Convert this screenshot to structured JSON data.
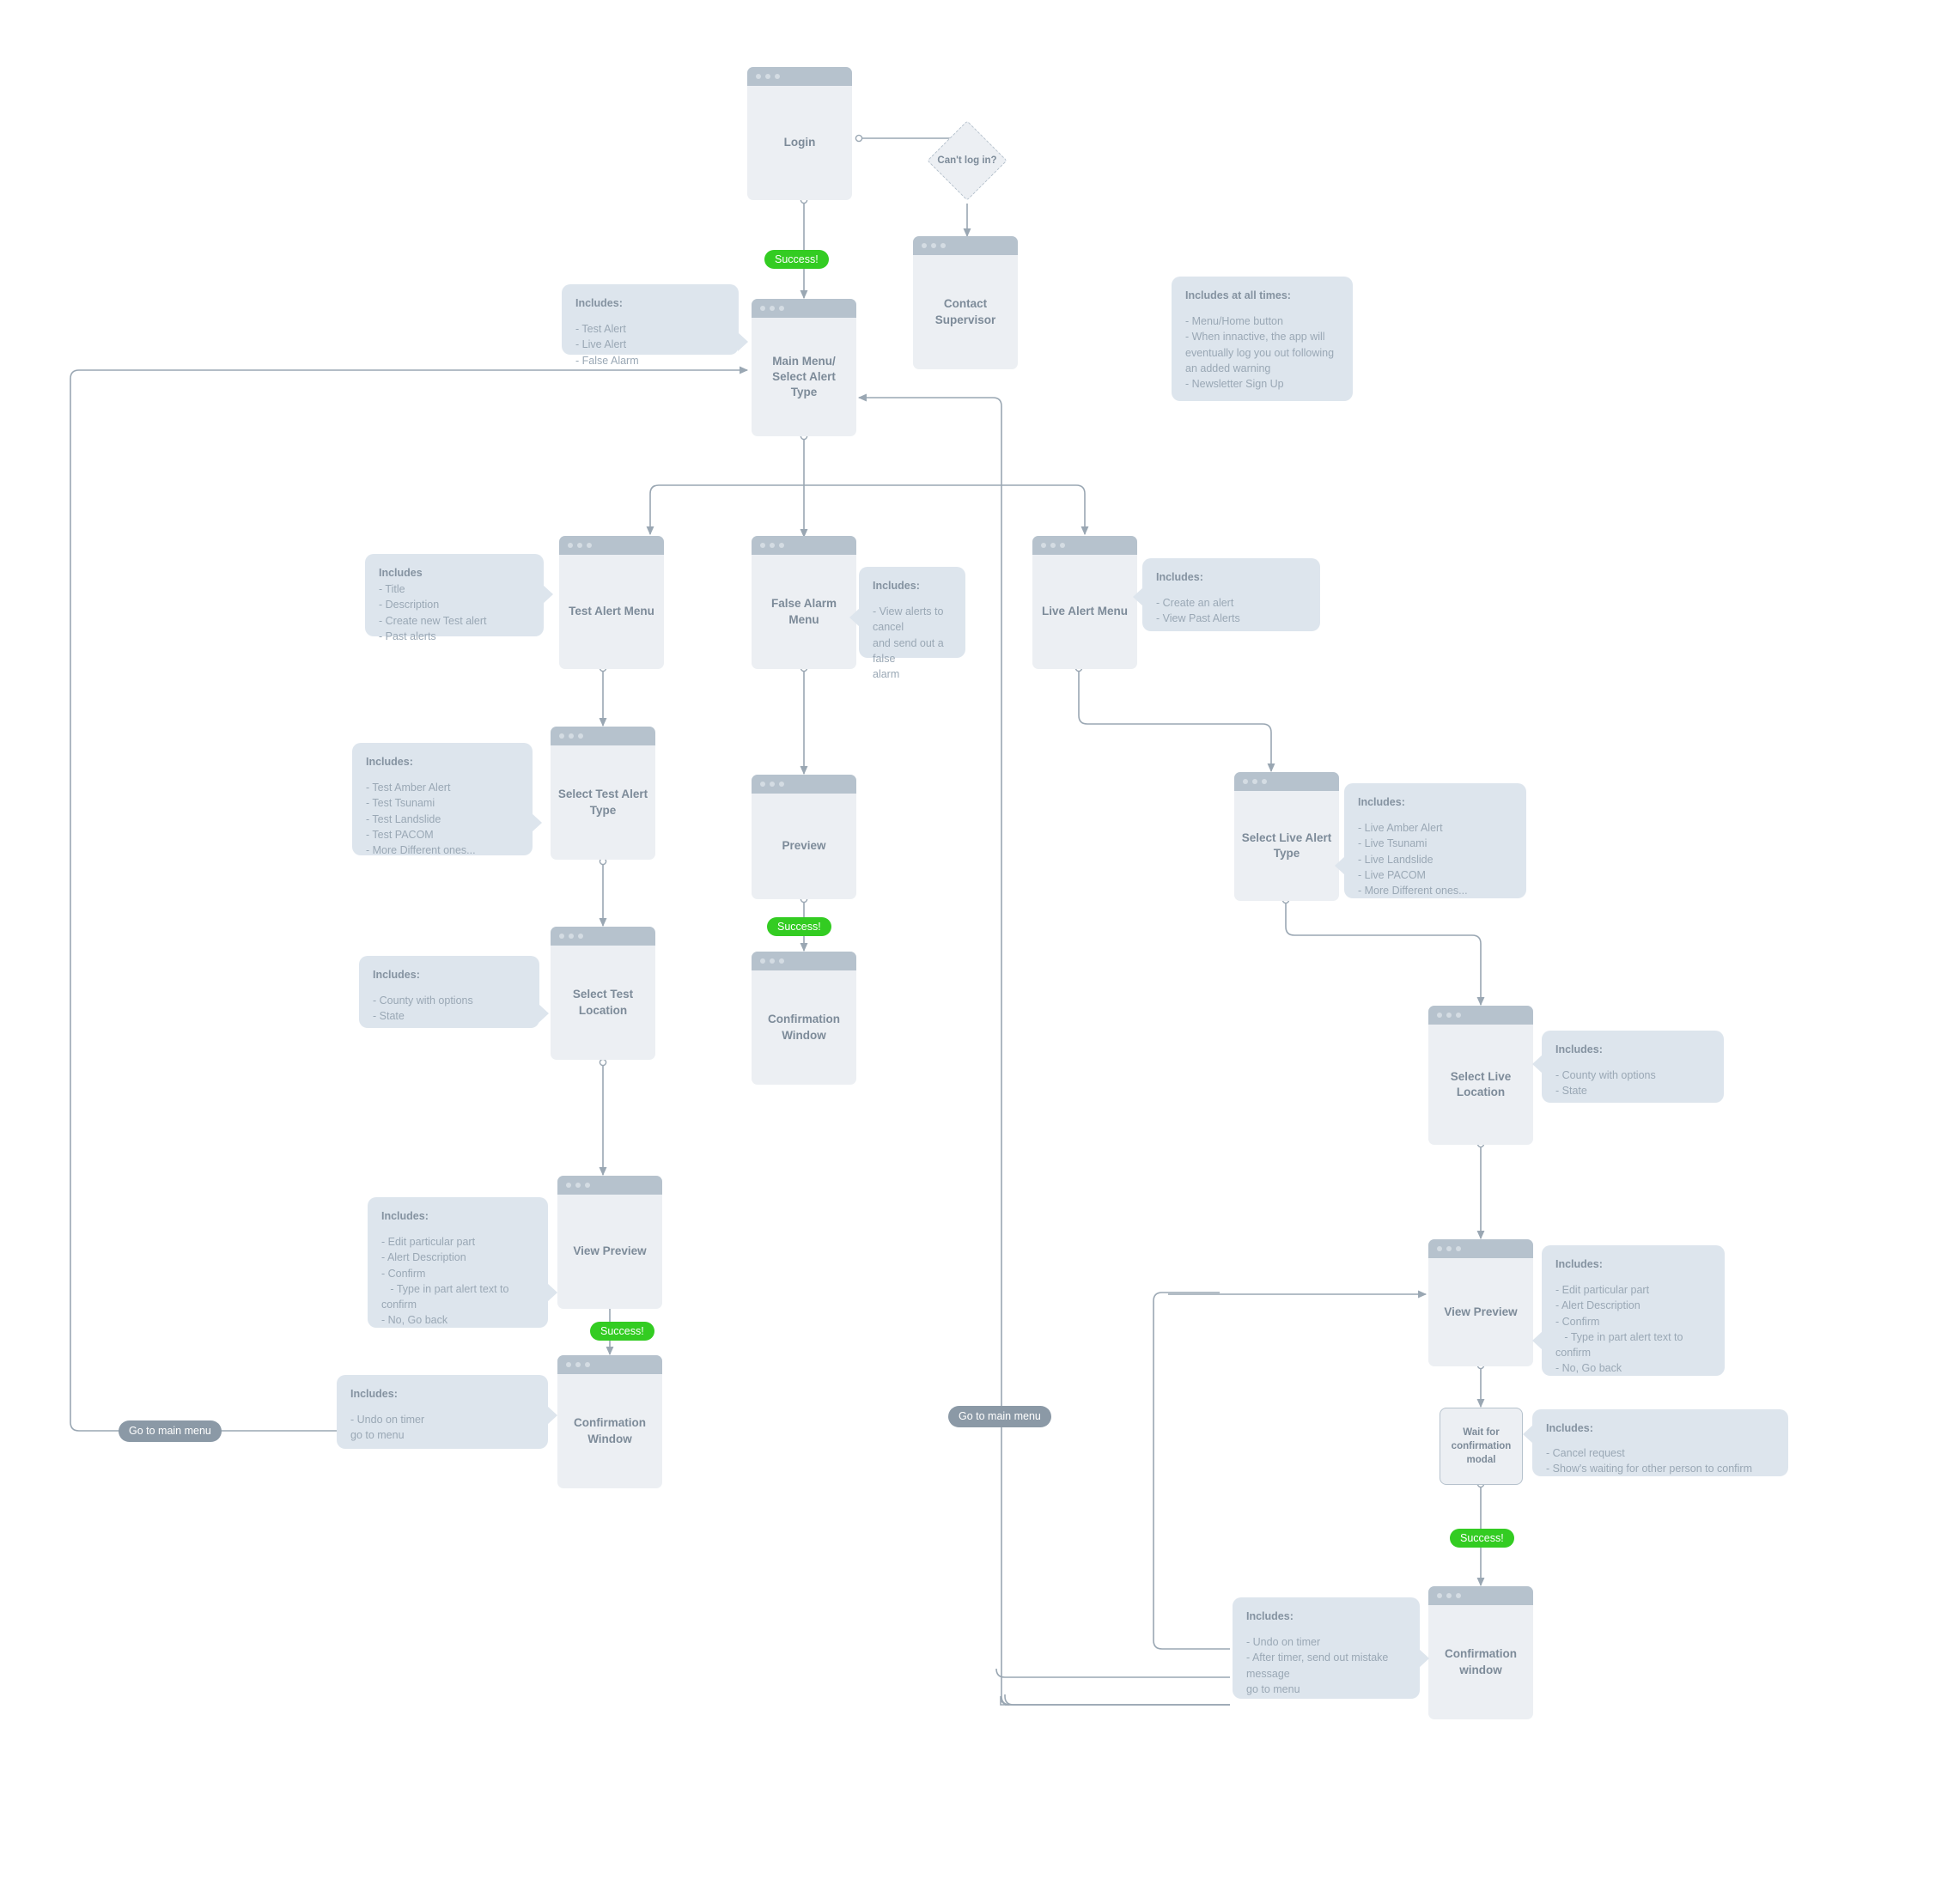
{
  "diagram": {
    "title": "Emergency Alert App User Flow",
    "colors": {
      "screen_body": "#eceff3",
      "screen_titlebar": "#b6c2cd",
      "note_bg": "#dde5ed",
      "note_title": "#8593a1",
      "note_text": "#9aa8b5",
      "label_text": "#7d8b99",
      "success_green": "#33cc22",
      "jump_pill": "#8b99a6",
      "wire": "#9aa7b3"
    },
    "nodes": {
      "login": {
        "label": "Login"
      },
      "cant_log_in": {
        "label": "Can't log in?"
      },
      "contact_supervisor": {
        "label": "Contact Supervisor"
      },
      "main_menu": {
        "label": "Main Menu/\nSelect Alert Type"
      },
      "test_alert_menu": {
        "label": "Test Alert Menu"
      },
      "false_alarm_menu": {
        "label": "False Alarm Menu"
      },
      "live_alert_menu": {
        "label": "Live Alert Menu"
      },
      "select_test_alert_type": {
        "label": "Select Test Alert\nType"
      },
      "select_test_location": {
        "label": "Select Test\nLocation"
      },
      "test_view_preview": {
        "label": "View Preview"
      },
      "test_confirmation_window": {
        "label": "Confirmation\nWindow"
      },
      "false_preview": {
        "label": "Preview"
      },
      "false_confirmation_window": {
        "label": "Confirmation\nWindow"
      },
      "select_live_alert_type": {
        "label": "Select Live Alert\nType"
      },
      "select_live_location": {
        "label": "Select Live\nLocation"
      },
      "live_view_preview": {
        "label": "View Preview"
      },
      "wait_for_confirmation_modal": {
        "label": "Wait for\nconfirmation\nmodal"
      },
      "live_confirmation_window": {
        "label": "Confirmation\nwindow"
      }
    },
    "pills": {
      "success_login": "Success!",
      "success_test": "Success!",
      "success_false": "Success!",
      "success_live": "Success!",
      "jump_left": "Go to main menu",
      "jump_right": "Go to main menu"
    },
    "notes": {
      "main_menu": {
        "title": "Includes:",
        "lines": [
          "- Test Alert",
          "- Live Alert",
          "- False Alarm"
        ]
      },
      "at_all_times": {
        "title": "Includes at all times:",
        "lines": [
          "- Menu/Home button",
          "- When innactive, the app will",
          "eventually log you out following",
          "an added warning",
          "- Newsletter Sign Up"
        ]
      },
      "test_alert_menu": {
        "title": "Includes",
        "lines": [
          "- Title",
          "- Description",
          "- Create new Test alert",
          "- Past alerts"
        ]
      },
      "false_alarm_menu": {
        "title": "Includes:",
        "lines": [
          "- View alerts to cancel",
          "and send out a false",
          "alarm"
        ]
      },
      "live_alert_menu": {
        "title": "Includes:",
        "lines": [
          "- Create an alert",
          "- View Past Alerts"
        ]
      },
      "select_test_alert_type": {
        "title": "Includes:",
        "lines": [
          "- Test Amber Alert",
          "- Test Tsunami",
          "- Test Landslide",
          "- Test PACOM",
          "- More Different ones..."
        ]
      },
      "select_test_location": {
        "title": "Includes:",
        "lines": [
          "- County with options",
          "- State"
        ]
      },
      "test_view_preview": {
        "title": "Includes:",
        "lines": [
          "- Edit particular part",
          "- Alert Description",
          "- Confirm",
          "   - Type in part alert text to",
          "confirm",
          "- No, Go back"
        ]
      },
      "test_confirmation_window": {
        "title": "Includes:",
        "lines": [
          "- Undo on timer",
          "go to menu"
        ]
      },
      "select_live_alert_type": {
        "title": "Includes:",
        "lines": [
          "- Live Amber Alert",
          "- Live Tsunami",
          "- Live Landslide",
          "- Live PACOM",
          "- More Different ones..."
        ]
      },
      "select_live_location": {
        "title": "Includes:",
        "lines": [
          "- County with options",
          "- State"
        ]
      },
      "live_view_preview": {
        "title": "Includes:",
        "lines": [
          "- Edit particular part",
          "- Alert Description",
          "- Confirm",
          "   - Type in part alert text to",
          "confirm",
          "- No, Go back"
        ]
      },
      "wait_for_confirmation_modal": {
        "title": "Includes:",
        "lines": [
          "- Cancel request",
          "- Show's waiting for other person to confirm"
        ]
      },
      "live_confirmation_window": {
        "title": "Includes:",
        "lines": [
          "- Undo on timer",
          "- After timer, send out mistake",
          "message",
          "go to menu"
        ]
      }
    }
  }
}
